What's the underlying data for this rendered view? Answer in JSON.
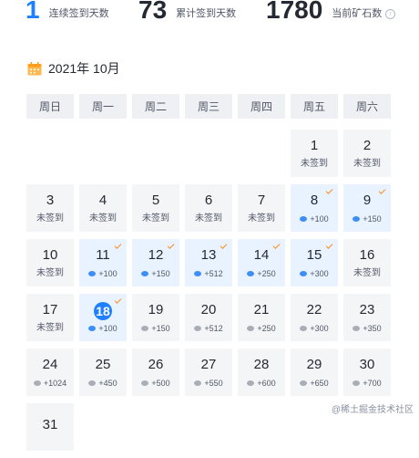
{
  "stats": {
    "consecutive_days": "1",
    "consecutive_label": "连续签到天数",
    "total_days": "73",
    "total_label": "累计签到天数",
    "ore": "1780",
    "ore_label": "当前矿石数",
    "info_icon": "info-icon"
  },
  "calendar": {
    "month_label": "2021年 10月",
    "icon": "calendar-icon",
    "weekdays": [
      "周日",
      "周一",
      "周二",
      "周三",
      "周四",
      "周五",
      "周六"
    ],
    "unsigned_label": "未签到",
    "weeks": [
      [
        null,
        null,
        null,
        null,
        null,
        {
          "day": "1",
          "state": "unsigned"
        },
        {
          "day": "2",
          "state": "unsigned"
        }
      ],
      [
        {
          "day": "3",
          "state": "unsigned"
        },
        {
          "day": "4",
          "state": "unsigned"
        },
        {
          "day": "5",
          "state": "unsigned"
        },
        {
          "day": "6",
          "state": "unsigned"
        },
        {
          "day": "7",
          "state": "unsigned"
        },
        {
          "day": "8",
          "state": "signed",
          "ore": "+100"
        },
        {
          "day": "9",
          "state": "signed",
          "ore": "+150"
        }
      ],
      [
        {
          "day": "10",
          "state": "unsigned"
        },
        {
          "day": "11",
          "state": "signed",
          "ore": "+100"
        },
        {
          "day": "12",
          "state": "signed",
          "ore": "+150"
        },
        {
          "day": "13",
          "state": "signed",
          "ore": "+512"
        },
        {
          "day": "14",
          "state": "signed",
          "ore": "+250"
        },
        {
          "day": "15",
          "state": "signed",
          "ore": "+300"
        },
        {
          "day": "16",
          "state": "unsigned"
        }
      ],
      [
        {
          "day": "17",
          "state": "unsigned"
        },
        {
          "day": "18",
          "state": "today",
          "ore": "+100"
        },
        {
          "day": "19",
          "state": "future",
          "ore": "+150"
        },
        {
          "day": "20",
          "state": "future",
          "ore": "+512"
        },
        {
          "day": "21",
          "state": "future",
          "ore": "+250"
        },
        {
          "day": "22",
          "state": "future",
          "ore": "+300"
        },
        {
          "day": "23",
          "state": "future",
          "ore": "+350"
        }
      ],
      [
        {
          "day": "24",
          "state": "future",
          "ore": "+1024"
        },
        {
          "day": "25",
          "state": "future",
          "ore": "+450"
        },
        {
          "day": "26",
          "state": "future",
          "ore": "+500"
        },
        {
          "day": "27",
          "state": "future",
          "ore": "+550"
        },
        {
          "day": "28",
          "state": "future",
          "ore": "+600"
        },
        {
          "day": "29",
          "state": "future",
          "ore": "+650"
        },
        {
          "day": "30",
          "state": "future",
          "ore": "+700"
        }
      ],
      [
        {
          "day": "31",
          "state": "future",
          "ore": ""
        },
        null,
        null,
        null,
        null,
        null,
        null
      ]
    ]
  },
  "watermark": {
    "text": "@稀土掘金技术社区"
  },
  "colors": {
    "accent": "#1e80ff",
    "signed_bg": "#e8f3ff",
    "unsigned_bg": "#f4f5f7",
    "check": "#ff8e1a"
  }
}
